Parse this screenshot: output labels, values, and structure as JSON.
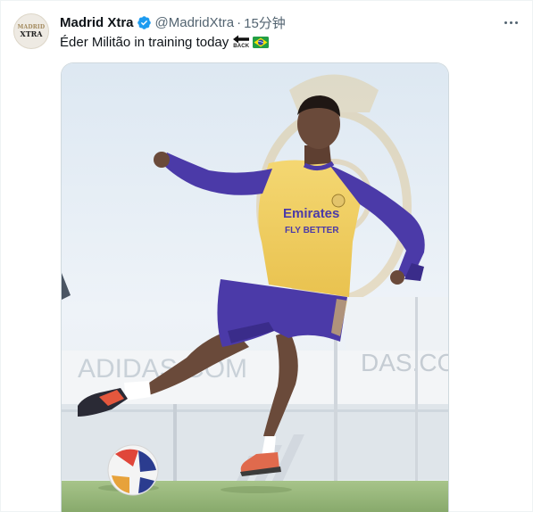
{
  "tweet": {
    "avatar_text_top": "MADRID",
    "avatar_text_bottom": "XTRA",
    "display_name": "Madrid Xtra",
    "handle": "@MadridXtra",
    "separator": "·",
    "time": "15分钟",
    "text": "Éder Militão in training today",
    "emoji_back_label": "BACK",
    "emoji_flag": "brazil-flag-icon",
    "verified_icon": "verified-badge-icon",
    "more_icon": "more-options-icon",
    "colors": {
      "verified": "#1d9bf0",
      "text": "#0f1419",
      "secondary": "#536471",
      "jersey_yellow": "#f2cf5e",
      "jersey_purple": "#4b3aa8"
    },
    "photo": {
      "description_icon": "player-training-photo",
      "bg_crest_text": "ADIDAS COM",
      "bg_crest_text2": "DAS.COM",
      "sponsor_line1": "Emirates",
      "sponsor_line2": "FLY BETTER"
    }
  }
}
